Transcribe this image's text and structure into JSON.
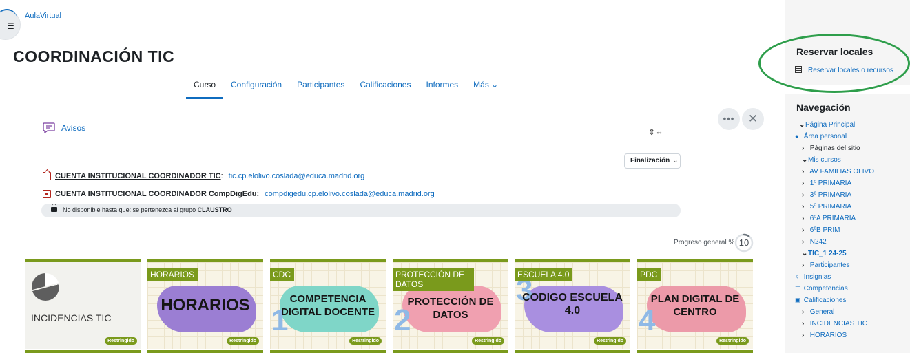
{
  "breadcrumb": "AulaVirtual",
  "page_title": "COORDINACIÓN TIC",
  "course_nav": {
    "tabs": [
      {
        "label": "Curso",
        "active": true
      },
      {
        "label": "Configuración"
      },
      {
        "label": "Participantes"
      },
      {
        "label": "Calificaciones"
      },
      {
        "label": "Informes"
      },
      {
        "label": "Más ⌄"
      }
    ]
  },
  "controls": {
    "more": "•••",
    "close": "✕"
  },
  "section": {
    "avisos_label": "Avisos",
    "sort_select": "Finalización",
    "sort_chevron": "⌄",
    "accounts": [
      {
        "label": "CUENTA INSTITUCIONAL COORDINADOR TIC",
        "sep": ":",
        "value": "tic.cp.elolivo.coslada@educa.madrid.org"
      },
      {
        "label": "CUENTA INSTITUCIONAL COORDINADOR CompDigEdu:",
        "sep": "",
        "value": "compdigedu.cp.elolivo.coslada@educa.madrid.org"
      }
    ],
    "restriction_prefix": "No disponible hasta que: se pertenezca al grupo",
    "restriction_group": "CLAUSTRO"
  },
  "progress": {
    "label": "Progreso general %",
    "value": "10",
    "fraction": 0.1
  },
  "cards": [
    {
      "tag": "",
      "title": "INCIDENCIAS TIC",
      "badge": "Restringido"
    },
    {
      "tag": "HORARIOS",
      "title": "HORARIOS",
      "number": "",
      "badge": "Restringido",
      "blob_color": "#9b7ed3"
    },
    {
      "tag": "CDC",
      "title": "COMPETENCIA DIGITAL DOCENTE",
      "number": "1",
      "badge": "Restringido",
      "blob_color": "#7fd6c8"
    },
    {
      "tag": "PROTECCIÓN DE DATOS",
      "title": "PROTECCIÓN DE DATOS",
      "number": "2",
      "badge": "Restringido",
      "blob_color": "#f0a0b0"
    },
    {
      "tag": "ESCUELA 4.0",
      "title": "CODIGO ESCUELA 4.0",
      "number": "3",
      "badge": "Restringido",
      "blob_color": "#a98fe0"
    },
    {
      "tag": "PDC",
      "title": "PLAN DIGITAL DE CENTRO",
      "number": "4",
      "badge": "Restringido",
      "blob_color": "#ec9aa9"
    }
  ],
  "reservar": {
    "title": "Reservar locales",
    "link": "Reservar locales o recursos"
  },
  "navegacion": {
    "title": "Navegación",
    "items": [
      {
        "label": "Página Principal",
        "prefix": "⌄"
      },
      {
        "label": "Área personal",
        "prefix": "●"
      },
      {
        "label": "Páginas del sitio",
        "prefix": "›"
      },
      {
        "label": "Mis cursos",
        "prefix": "⌄"
      },
      {
        "label": "AV FAMILIAS OLIVO",
        "prefix": "›"
      },
      {
        "label": "1º PRIMARIA",
        "prefix": "›"
      },
      {
        "label": "3º PRIMARIA",
        "prefix": "›"
      },
      {
        "label": "5º PRIMARIA",
        "prefix": "›"
      },
      {
        "label": "6ºA PRIMARIA",
        "prefix": "›"
      },
      {
        "label": "6ºB PRIM",
        "prefix": "›"
      },
      {
        "label": "N242",
        "prefix": "›"
      },
      {
        "label": "TIC_1 24-25",
        "prefix": "⌄"
      },
      {
        "label": "Participantes",
        "prefix": "›"
      },
      {
        "label": "Insignias",
        "prefix": "♀"
      },
      {
        "label": "Competencias",
        "prefix": "☰"
      },
      {
        "label": "Calificaciones",
        "prefix": "▣"
      },
      {
        "label": "General",
        "prefix": "›"
      },
      {
        "label": "INCIDENCIAS TIC",
        "prefix": "›"
      },
      {
        "label": "HORARIOS",
        "prefix": "›"
      }
    ]
  }
}
